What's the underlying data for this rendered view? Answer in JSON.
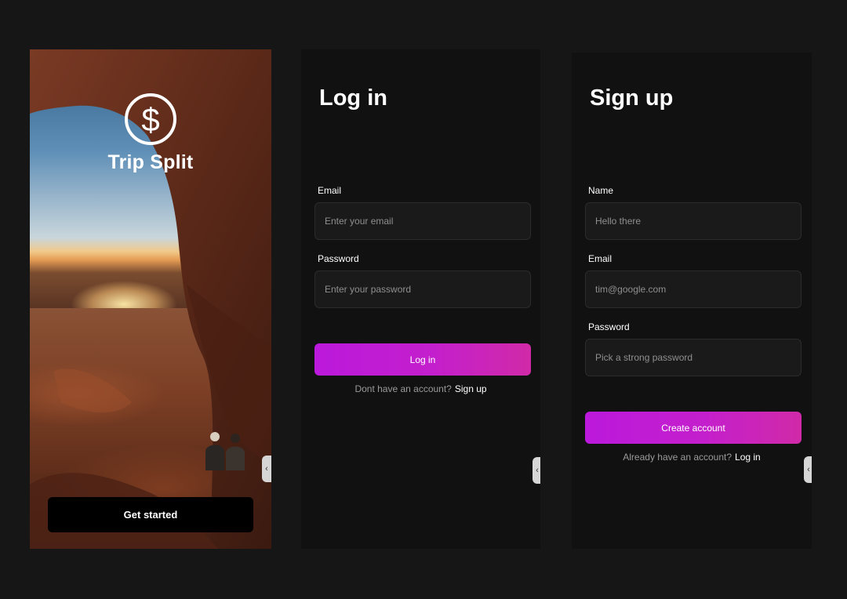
{
  "splash": {
    "brand_name": "Trip Split",
    "logo_icon": "dollar-coin-icon",
    "get_started_label": "Get started",
    "edge_tab_icon": "chevron-left-icon"
  },
  "login": {
    "title": "Log in",
    "email_label": "Email",
    "email_placeholder": "Enter your email",
    "password_label": "Password",
    "password_placeholder": "Enter your password",
    "submit_label": "Log in",
    "switch_prompt": "Dont have an account?",
    "switch_link": "Sign up"
  },
  "signup": {
    "title": "Sign up",
    "name_label": "Name",
    "name_placeholder": "Hello there",
    "email_label": "Email",
    "email_placeholder": "tim@google.com",
    "password_label": "Password",
    "password_placeholder": "Pick a strong password",
    "submit_label": "Create account",
    "switch_prompt": "Already have an account?",
    "switch_link": "Log in"
  },
  "colors": {
    "page_bg": "#161616",
    "screen_bg": "#111111",
    "field_bg": "#1a1a1a",
    "accent_start": "#bb19dc",
    "accent_end": "#d02aa8"
  }
}
